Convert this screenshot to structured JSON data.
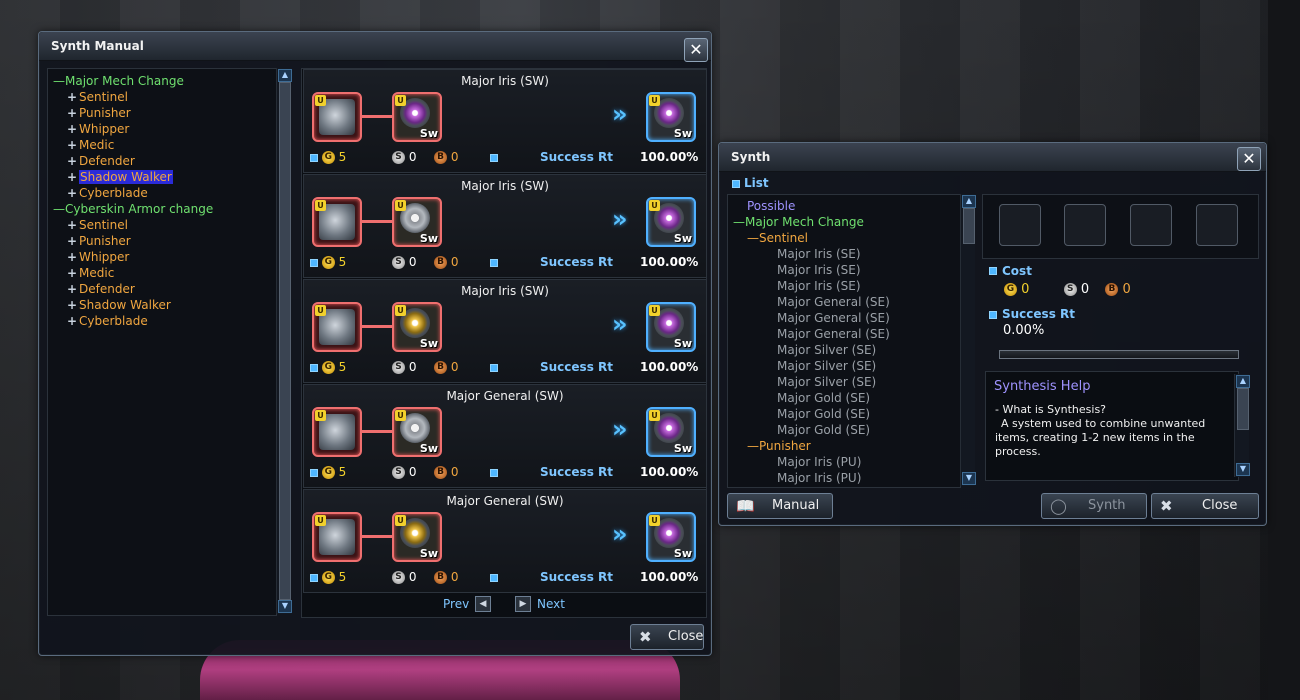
{
  "manual": {
    "title": "Synth Manual",
    "close_glyph": "✕",
    "tree": [
      {
        "label": "Major Mech Change",
        "kind": "group"
      },
      {
        "label": "Sentinel",
        "kind": "item"
      },
      {
        "label": "Punisher",
        "kind": "item"
      },
      {
        "label": "Whipper",
        "kind": "item"
      },
      {
        "label": "Medic",
        "kind": "item"
      },
      {
        "label": "Defender",
        "kind": "item"
      },
      {
        "label": "Shadow Walker",
        "kind": "item",
        "selected": true
      },
      {
        "label": "Cyberblade",
        "kind": "item"
      },
      {
        "label": "Cyberskin Armor change",
        "kind": "group"
      },
      {
        "label": "Sentinel",
        "kind": "item"
      },
      {
        "label": "Punisher",
        "kind": "item"
      },
      {
        "label": "Whipper",
        "kind": "item"
      },
      {
        "label": "Medic",
        "kind": "item"
      },
      {
        "label": "Defender",
        "kind": "item"
      },
      {
        "label": "Shadow Walker",
        "kind": "item"
      },
      {
        "label": "Cyberblade",
        "kind": "item"
      }
    ],
    "recipes": [
      {
        "name": "Major Iris (SW)",
        "gold": "5",
        "silver": "0",
        "bronze": "0",
        "rate_label": "Success Rt",
        "rate": "100.00%",
        "gem": "purple"
      },
      {
        "name": "Major Iris (SW)",
        "gold": "5",
        "silver": "0",
        "bronze": "0",
        "rate_label": "Success Rt",
        "rate": "100.00%",
        "gem": "gray"
      },
      {
        "name": "Major Iris (SW)",
        "gold": "5",
        "silver": "0",
        "bronze": "0",
        "rate_label": "Success Rt",
        "rate": "100.00%",
        "gem": "gold"
      },
      {
        "name": "Major General (SW)",
        "gold": "5",
        "silver": "0",
        "bronze": "0",
        "rate_label": "Success Rt",
        "rate": "100.00%",
        "gem": "gray"
      },
      {
        "name": "Major General (SW)",
        "gold": "5",
        "silver": "0",
        "bronze": "0",
        "rate_label": "Success Rt",
        "rate": "100.00%",
        "gem": "gold"
      }
    ],
    "item_tag": "Sw",
    "badge": "U",
    "pager": {
      "prev": "Prev",
      "next": "Next"
    },
    "close_label": "Close"
  },
  "synth": {
    "title": "Synth",
    "close_glyph": "✕",
    "list_label": "List",
    "list": [
      {
        "label": "Possible",
        "kind": "possible"
      },
      {
        "label": "Major Mech Change",
        "kind": "group"
      },
      {
        "label": "Sentinel",
        "kind": "sub"
      },
      {
        "label": "Major Iris (SE)",
        "kind": "leaf"
      },
      {
        "label": "Major Iris (SE)",
        "kind": "leaf"
      },
      {
        "label": "Major Iris (SE)",
        "kind": "leaf"
      },
      {
        "label": "Major General (SE)",
        "kind": "leaf"
      },
      {
        "label": "Major General (SE)",
        "kind": "leaf"
      },
      {
        "label": "Major General (SE)",
        "kind": "leaf"
      },
      {
        "label": "Major Silver (SE)",
        "kind": "leaf"
      },
      {
        "label": "Major Silver (SE)",
        "kind": "leaf"
      },
      {
        "label": "Major Silver (SE)",
        "kind": "leaf"
      },
      {
        "label": "Major Gold (SE)",
        "kind": "leaf"
      },
      {
        "label": "Major Gold (SE)",
        "kind": "leaf"
      },
      {
        "label": "Major Gold (SE)",
        "kind": "leaf"
      },
      {
        "label": "Punisher",
        "kind": "sub"
      },
      {
        "label": "Major Iris (PU)",
        "kind": "leaf"
      },
      {
        "label": "Major Iris (PU)",
        "kind": "leaf"
      }
    ],
    "cost_label": "Cost",
    "cost": {
      "gold": "0",
      "silver": "0",
      "bronze": "0"
    },
    "success_label": "Success Rt",
    "success_value": "0.00%",
    "progress": 0,
    "help": {
      "title": "Synthesis Help",
      "q": "- What is Synthesis?",
      "a": "A system used to combine unwanted items, creating 1-2 new items in the process."
    },
    "buttons": {
      "manual": "Manual",
      "synth": "Synth",
      "close": "Close"
    }
  },
  "colors": {
    "group": "#6fe06f",
    "item": "#f0a640",
    "leaf": "#9aa0a7",
    "possible": "#9f93ff",
    "accent": "#4fb7ff"
  }
}
